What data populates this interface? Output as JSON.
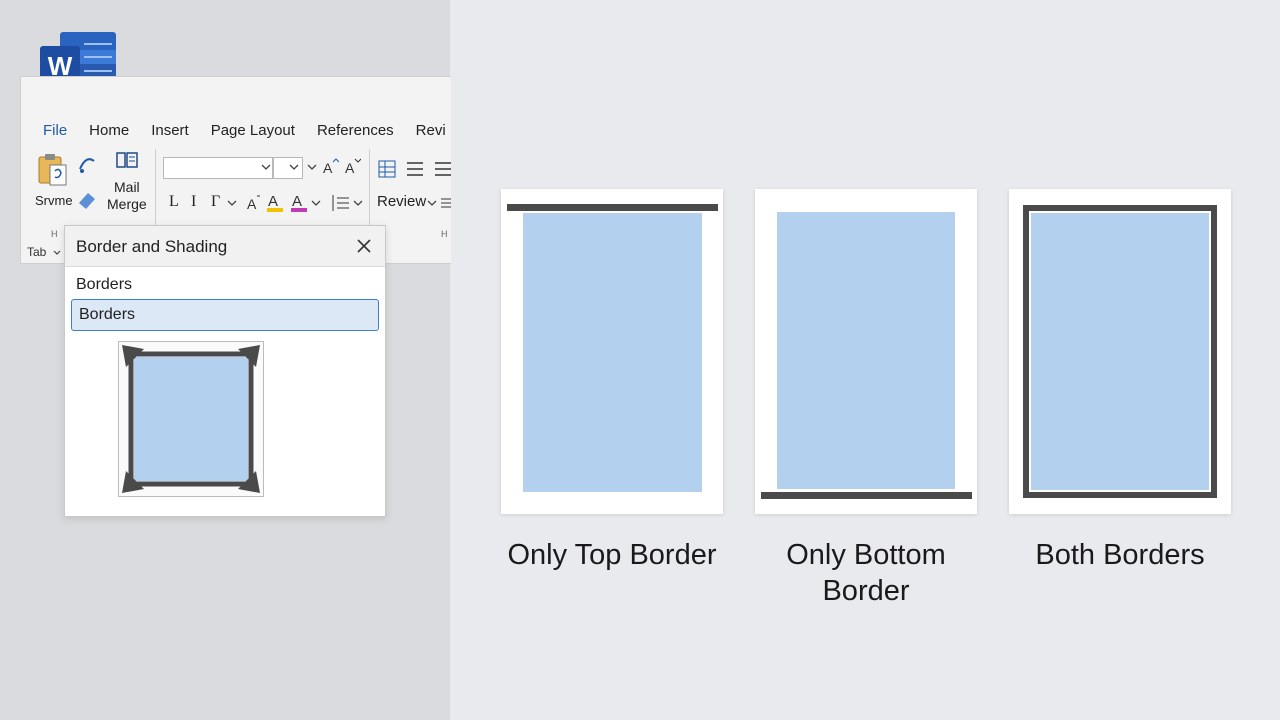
{
  "app": {
    "name": "Word",
    "logo_letter": "W"
  },
  "ribbon": {
    "tabs": [
      "File",
      "Home",
      "Insert",
      "Page Layout",
      "References",
      "Revi"
    ],
    "active_tab": "File",
    "buttons": {
      "paste_label": "Srvme",
      "mail_merge_label": "Mail\nMerge",
      "review_label": "Review",
      "group_letter_1": "H",
      "group_letter_2": "H",
      "font_btn_1": "L",
      "font_btn_2": "I",
      "font_btn_3": "Γ",
      "tab_dropdown": "Tab"
    }
  },
  "dialog": {
    "title": "Border and Shading",
    "section_label": "Borders",
    "selected_option": "Borders"
  },
  "examples": [
    {
      "caption": "Only Top Border",
      "border": "top"
    },
    {
      "caption": "Only Bottom Border",
      "border": "bottom"
    },
    {
      "caption": "Both Borders",
      "border": "box"
    }
  ],
  "colors": {
    "fill": "#b3d1ee",
    "border": "#4a4a4a",
    "accent": "#1e5aa8"
  }
}
